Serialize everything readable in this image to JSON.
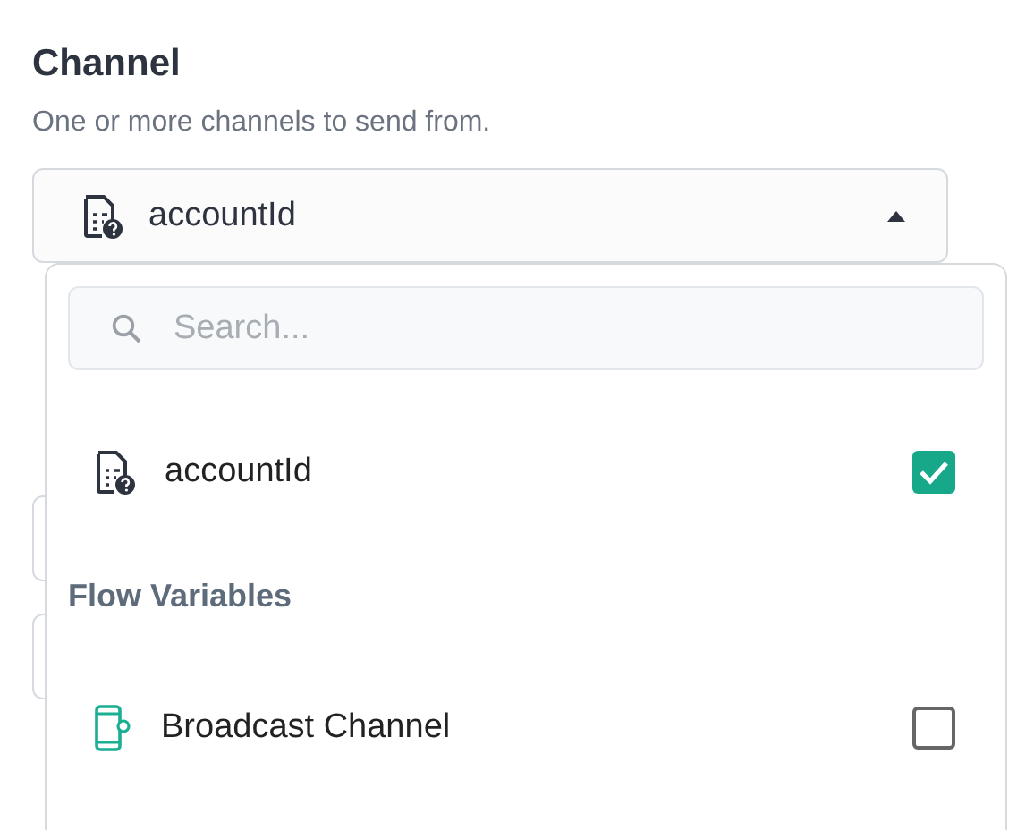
{
  "section": {
    "title": "Channel",
    "description": "One or more channels to send from."
  },
  "select": {
    "value": "accountId",
    "expanded": true
  },
  "dropdown": {
    "search": {
      "placeholder": "Search..."
    },
    "options": [
      {
        "kind": "variable",
        "label": "accountId",
        "checked": true
      }
    ],
    "groups": [
      {
        "title": "Flow Variables",
        "options": [
          {
            "kind": "channel",
            "label": "Broadcast Channel",
            "checked": false
          }
        ]
      }
    ]
  }
}
